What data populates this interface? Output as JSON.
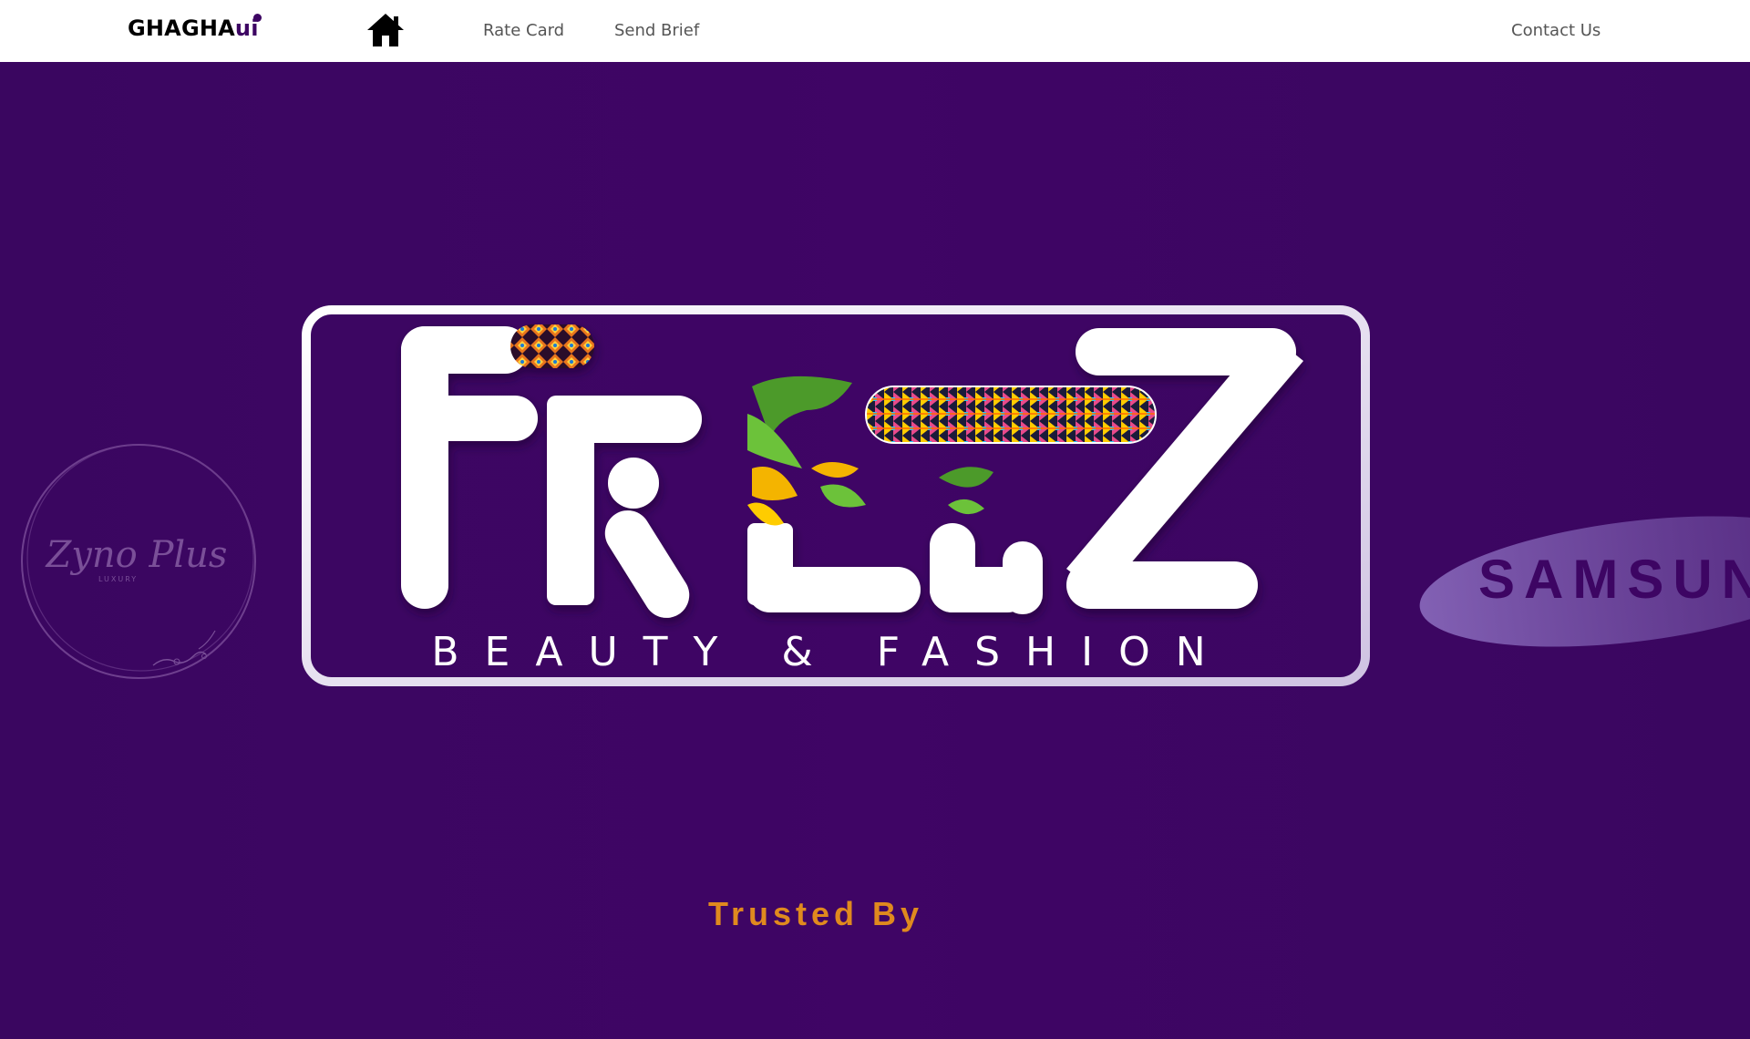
{
  "nav": {
    "brand_main": "GHAGHA",
    "brand_suffix": "ui",
    "links": [
      "Rate Card",
      "Send Brief"
    ],
    "contact": "Contact Us",
    "home_icon": "home-icon"
  },
  "hero": {
    "logo_wordmark": "FREEZ",
    "logo_tagline": "BEAUTY & FASHION",
    "clients": [
      "Zyno Plus",
      "SAMSUNG"
    ],
    "trusted_label": "Trusted By"
  },
  "colors": {
    "primary": "#3d0563",
    "accent": "#e08a1e",
    "white": "#ffffff"
  }
}
